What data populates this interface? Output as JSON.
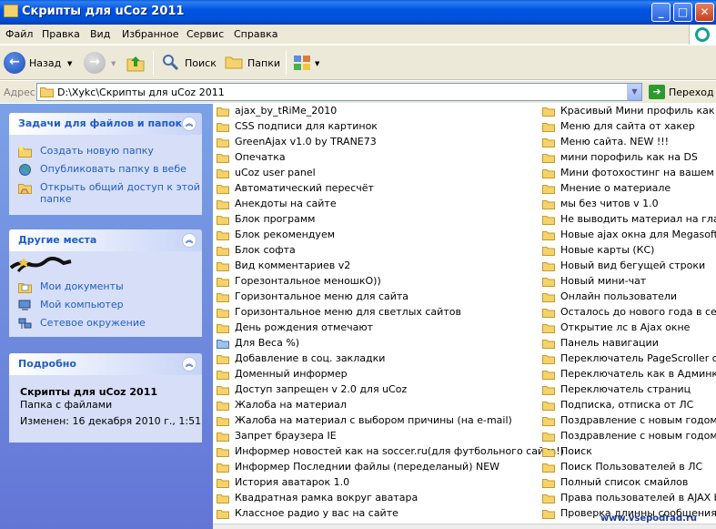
{
  "window": {
    "title": "Скрипты для uCoz 2011"
  },
  "menu": [
    "Файл",
    "Правка",
    "Вид",
    "Избранное",
    "Сервис",
    "Справка"
  ],
  "toolbar": {
    "back_label": "Назад",
    "search_label": "Поиск",
    "folders_label": "Папки"
  },
  "address": {
    "label": "Адрес:",
    "value": "D:\\Xykc\\Скрипты для uCoz 2011",
    "go_label": "Переход"
  },
  "tasks_panel": {
    "title": "Задачи для файлов и папок",
    "items": [
      {
        "icon": "new-folder-icon",
        "label": "Создать новую папку"
      },
      {
        "icon": "publish-web-icon",
        "label": "Опубликовать папку в вебе"
      },
      {
        "icon": "share-folder-icon",
        "label": "Открыть общий доступ к этой",
        "label2": "папке"
      }
    ]
  },
  "places_panel": {
    "title": "Другие места",
    "items": [
      {
        "icon": "my-documents-icon",
        "label": "Мои документы"
      },
      {
        "icon": "my-computer-icon",
        "label": "Мой компьютер"
      },
      {
        "icon": "network-places-icon",
        "label": "Сетевое окружение"
      }
    ]
  },
  "details_panel": {
    "title": "Подробно",
    "name": "Скрипты для uCoz 2011",
    "type": "Папка с файлами",
    "modified": "Изменен: 16 декабря 2010 г., 1:51"
  },
  "files_col1": [
    "ajax_by_tRiMe_2010",
    "CSS подписи для картинок",
    "GreenAjax v1.0 by TRANE73",
    "Опечатка",
    "uCoz user panel",
    "Автоматический пересчёт",
    "Анекдоты на сайте",
    "Блок программ",
    "Блок рекомендуем",
    "Блок софта",
    "Вид комментариев v2",
    "Горезонтальное меношкО))",
    "Горизонтальное меню для сайта",
    "Горизонтальное меню для светлых сайтов",
    "День рождения отмечают",
    "Для Веса %)",
    "Добавление в соц. закладки",
    "Доменный информер",
    "Доступ запрещен v 2.0 для uCoz",
    "Жалоба на материал",
    "Жалоба на материал с выбором причины (на e-mail)",
    "Запрет браузера IE",
    "Информер новостей как на soccer.ru(для футбольного сайта!)",
    "Информер Последнии файлы (переделаный) NEW",
    "История аватарок 1.0",
    "Квадратная рамка вокруг аватара",
    "Классное радио у вас на сайте"
  ],
  "files_col2": [
    "Красивый Мини профиль как на О",
    "Меню для сайта от хакер",
    "Меню сайта. NEW !!!",
    "мини порофиль как на DS",
    "Мини фотохостинг на вашем сайте",
    "Мнение о материале",
    "мы без читов v 1.0",
    "Не выводить материал на главно",
    "Новые ajax окна для Megasoft",
    "Новые карты (КС)",
    "Новый вид бегущей строки",
    "Новый мини-чат",
    "Онлайн пользователи",
    "Осталось до нового года в секунд",
    "Открытие лс в Ajax окне",
    "Панель навигации",
    "Переключатель PageScroller от AD",
    "Переключатель как в Админке UC",
    "Переключатель страниц",
    "Подписка, отписка от ЛС",
    "Поздравление с новым годом",
    "Поздравление с новым годом для",
    "Поиск",
    "Поиск Пользователей в ЛС",
    "Полный список смайлов",
    "Права пользователей в AJAX by S",
    "Проверка длинны сообщения для"
  ],
  "watermark": "www.vsepodrad.ru",
  "colors": {
    "titlebar": "#0054e3",
    "taskpane": "#6e8ee0",
    "link": "#215dc6",
    "folder": "#f4d36c"
  }
}
